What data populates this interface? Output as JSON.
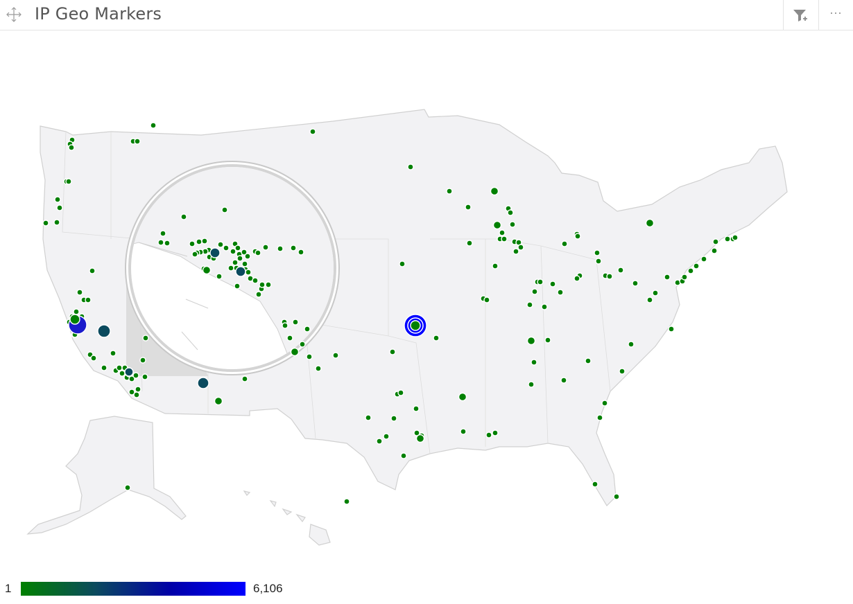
{
  "header": {
    "title": "IP Geo Markers",
    "icons": {
      "move": "move-icon",
      "filter": "filter-add-icon",
      "more": "more-options-icon"
    },
    "more_label": "⋯"
  },
  "colors": {
    "marker_low": "#008000",
    "marker_mid": "#0b4a5e",
    "marker_high": "#0000ff",
    "land": "#f2f2f4",
    "border": "#d0d0d0"
  },
  "legend": {
    "min_label": "1",
    "max_label": "6,106"
  },
  "map": {
    "region": "United States",
    "inset": "magnifier over Southern California",
    "markers": [
      {
        "id": "denver-area",
        "lon": -95.6,
        "lat": 38.9,
        "count": 6106
      },
      {
        "id": "san-francisco",
        "lon": -122.3,
        "lat": 37.5,
        "count": 3800
      },
      {
        "id": "fresno",
        "lon": -119.4,
        "lat": 36.6,
        "count": 900
      },
      {
        "id": "phoenix",
        "lon": -112.0,
        "lat": 33.5,
        "count": 700
      },
      {
        "id": "los-angeles",
        "lon": -118.3,
        "lat": 34.0,
        "count": 500
      },
      {
        "id": "seattle",
        "lon": -122.3,
        "lat": 47.6,
        "count": 300
      },
      {
        "id": "portland",
        "lon": -122.7,
        "lat": 45.5,
        "count": 200
      },
      {
        "id": "houston",
        "lon": -95.4,
        "lat": 29.8,
        "count": 250
      },
      {
        "id": "chicago",
        "lon": -87.6,
        "lat": 41.9,
        "count": 200
      },
      {
        "id": "new-york",
        "lon": -74.0,
        "lat": 40.7,
        "count": 200
      }
    ]
  }
}
